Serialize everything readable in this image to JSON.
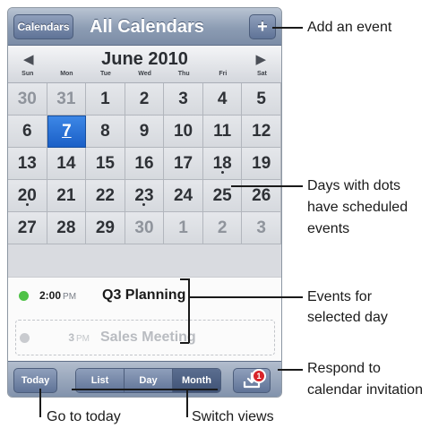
{
  "navbar": {
    "calendars_label": "Calendars",
    "title": "All Calendars",
    "add_label": "+"
  },
  "month": {
    "prev_arrow": "◀",
    "title": "June 2010",
    "next_arrow": "▶",
    "weekdays": [
      "Sun",
      "Mon",
      "Tue",
      "Wed",
      "Thu",
      "Fri",
      "Sat"
    ]
  },
  "days": [
    {
      "n": "30",
      "dim": true
    },
    {
      "n": "31",
      "dim": true
    },
    {
      "n": "1"
    },
    {
      "n": "2"
    },
    {
      "n": "3"
    },
    {
      "n": "4"
    },
    {
      "n": "5"
    },
    {
      "n": "6"
    },
    {
      "n": "7",
      "selected": true
    },
    {
      "n": "8"
    },
    {
      "n": "9"
    },
    {
      "n": "10"
    },
    {
      "n": "11"
    },
    {
      "n": "12"
    },
    {
      "n": "13"
    },
    {
      "n": "14"
    },
    {
      "n": "15"
    },
    {
      "n": "16"
    },
    {
      "n": "17"
    },
    {
      "n": "18",
      "dot": true
    },
    {
      "n": "19"
    },
    {
      "n": "20",
      "dot": true
    },
    {
      "n": "21"
    },
    {
      "n": "22"
    },
    {
      "n": "23",
      "dot": true
    },
    {
      "n": "24"
    },
    {
      "n": "25"
    },
    {
      "n": "26"
    },
    {
      "n": "27"
    },
    {
      "n": "28"
    },
    {
      "n": "29"
    },
    {
      "n": "30",
      "dim": true
    },
    {
      "n": "1",
      "dim": true
    },
    {
      "n": "2",
      "dim": true
    },
    {
      "n": "3",
      "dim": true
    }
  ],
  "events": [
    {
      "time": "2:00",
      "ampm": "PM",
      "name": "Q3 Planning",
      "dot_color": "#4fc247"
    },
    {
      "time": "3",
      "ampm": "PM",
      "name": "Sales Meeting",
      "dot_color": "#c9cbcf"
    }
  ],
  "toolbar": {
    "today_label": "Today",
    "views": [
      "List",
      "Day",
      "Month"
    ],
    "active_view": "Month",
    "inbox_icon": "inbox-download-icon",
    "badge_count": "1"
  },
  "callouts": {
    "add": "Add an event",
    "dots_1": "Days with dots",
    "dots_2": "have scheduled",
    "dots_3": "events",
    "events_1": "Events for",
    "events_2": "selected day",
    "respond_1": "Respond to",
    "respond_2": "calendar invitation",
    "today": "Go to today",
    "switch": "Switch views"
  },
  "colors": {
    "nav_blue": "#7b8ca6",
    "selected_day": "#1a5fc7",
    "badge_red": "#d8242a"
  }
}
